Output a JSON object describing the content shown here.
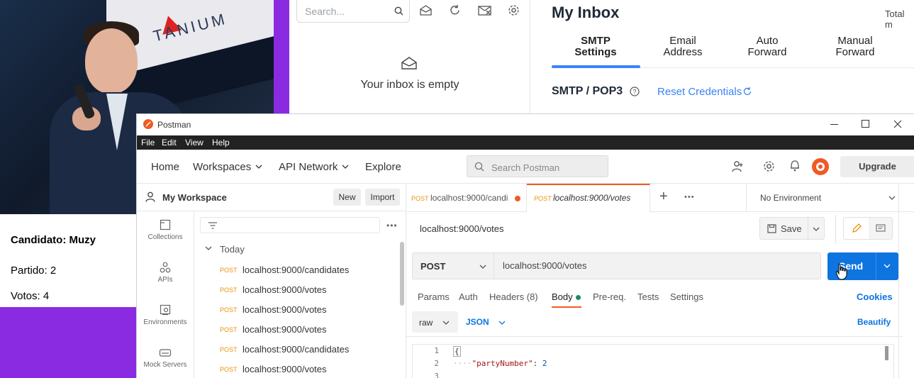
{
  "card": {
    "candidate": "Candidato: Muzy",
    "party": "Partido: 2",
    "votes": "Votos: 4"
  },
  "photo": {
    "banner_text": "TANIUM"
  },
  "mail": {
    "search_placeholder": "Search...",
    "empty_text": "Your inbox is empty",
    "inbox_title": "My Inbox",
    "total_label": "Total m",
    "tabs": [
      {
        "line1": "SMTP",
        "line2": "Settings"
      },
      {
        "line1": "Email",
        "line2": "Address"
      },
      {
        "line1": "Auto",
        "line2": "Forward"
      },
      {
        "line1": "Manual",
        "line2": "Forward"
      }
    ],
    "section_title": "SMTP / POP3",
    "reset_label": "Reset Credentials",
    "accent": "#3b82f6"
  },
  "postman": {
    "app_title": "Postman",
    "menu": [
      "File",
      "Edit",
      "View",
      "Help"
    ],
    "nav": {
      "home": "Home",
      "workspaces": "Workspaces",
      "api_network": "API Network",
      "explore": "Explore"
    },
    "search_placeholder": "Search Postman",
    "upgrade": "Upgrade",
    "workspace": "My Workspace",
    "new_btn": "New",
    "import_btn": "Import",
    "sidebar_items": [
      "Collections",
      "APIs",
      "Environments",
      "Mock Servers"
    ],
    "history_group": "Today",
    "history": [
      {
        "method": "POST",
        "url": "localhost:9000/candidates"
      },
      {
        "method": "POST",
        "url": "localhost:9000/votes"
      },
      {
        "method": "POST",
        "url": "localhost:9000/votes"
      },
      {
        "method": "POST",
        "url": "localhost:9000/votes"
      },
      {
        "method": "POST",
        "url": "localhost:9000/candidates"
      },
      {
        "method": "POST",
        "url": "localhost:9000/votes"
      }
    ],
    "tabs": [
      {
        "method": "POST",
        "label": "localhost:9000/candi"
      },
      {
        "method": "POST",
        "label": "localhost:9000/votes"
      }
    ],
    "environment": "No Environment",
    "request_name": "localhost:9000/votes",
    "save": "Save",
    "method": "POST",
    "url": "localhost:9000/votes",
    "send": "Send",
    "req_tabs": {
      "params": "Params",
      "auth": "Auth",
      "headers": "Headers (8)",
      "body": "Body",
      "prereq": "Pre-req.",
      "tests": "Tests",
      "settings": "Settings"
    },
    "cookies": "Cookies",
    "body_mode": "raw",
    "body_lang": "JSON",
    "beautify": "Beautify",
    "code_lines": [
      {
        "n": "1",
        "text": "{"
      },
      {
        "n": "2",
        "key": "\"partyNumber\"",
        "val": "2"
      },
      {
        "n": "3",
        "text": ""
      }
    ],
    "orange": "#e8930c",
    "send_color": "#0d74e0"
  }
}
